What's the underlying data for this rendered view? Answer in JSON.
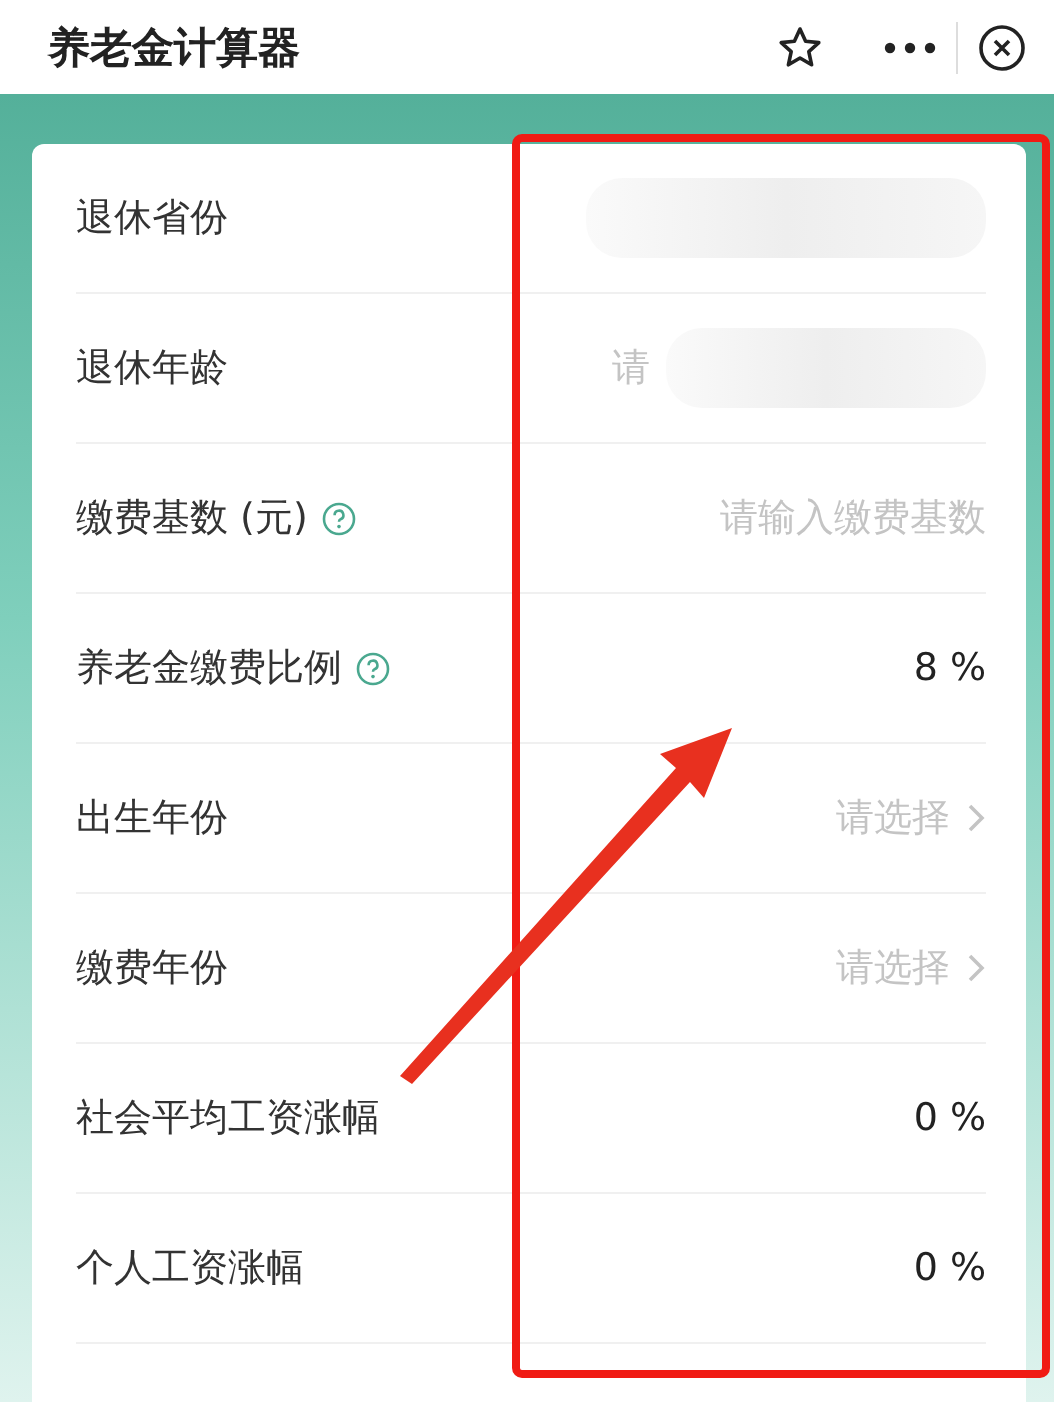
{
  "header": {
    "title": "养老金计算器"
  },
  "rows": [
    {
      "label": "退休省份",
      "kind": "blurred",
      "help": false
    },
    {
      "label": "退休年龄",
      "kind": "blurred",
      "placeholder": "请",
      "help": false
    },
    {
      "label": "缴费基数 (元)",
      "kind": "input",
      "placeholder": "请输入缴费基数",
      "help": true
    },
    {
      "label": "养老金缴费比例",
      "kind": "value",
      "value": "8 %",
      "help": true
    },
    {
      "label": "出生年份",
      "kind": "select",
      "placeholder": "请选择",
      "help": false
    },
    {
      "label": "缴费年份",
      "kind": "select",
      "placeholder": "请选择",
      "help": false
    },
    {
      "label": "社会平均工资涨幅",
      "kind": "value",
      "value": "0 %",
      "help": false
    },
    {
      "label": "个人工资涨幅",
      "kind": "value",
      "value": "0 %",
      "help": false
    }
  ]
}
